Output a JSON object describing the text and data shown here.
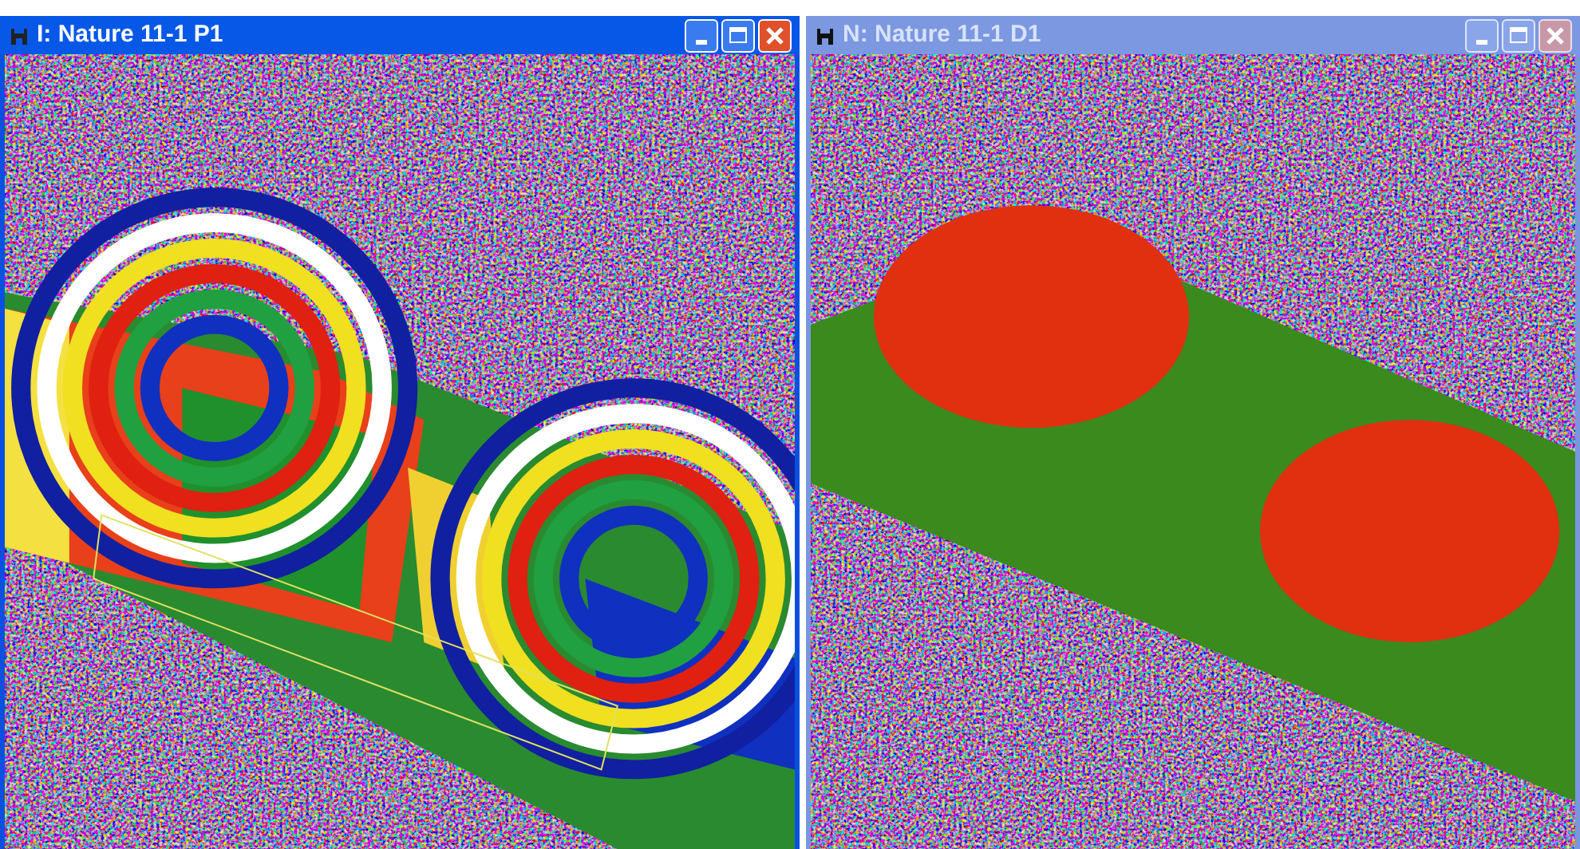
{
  "windows": [
    {
      "title": "I: Nature 11-1 P1",
      "active": true,
      "kind": "phase"
    },
    {
      "title": "N: Nature 11-1 D1",
      "active": false,
      "kind": "deformation"
    }
  ]
}
